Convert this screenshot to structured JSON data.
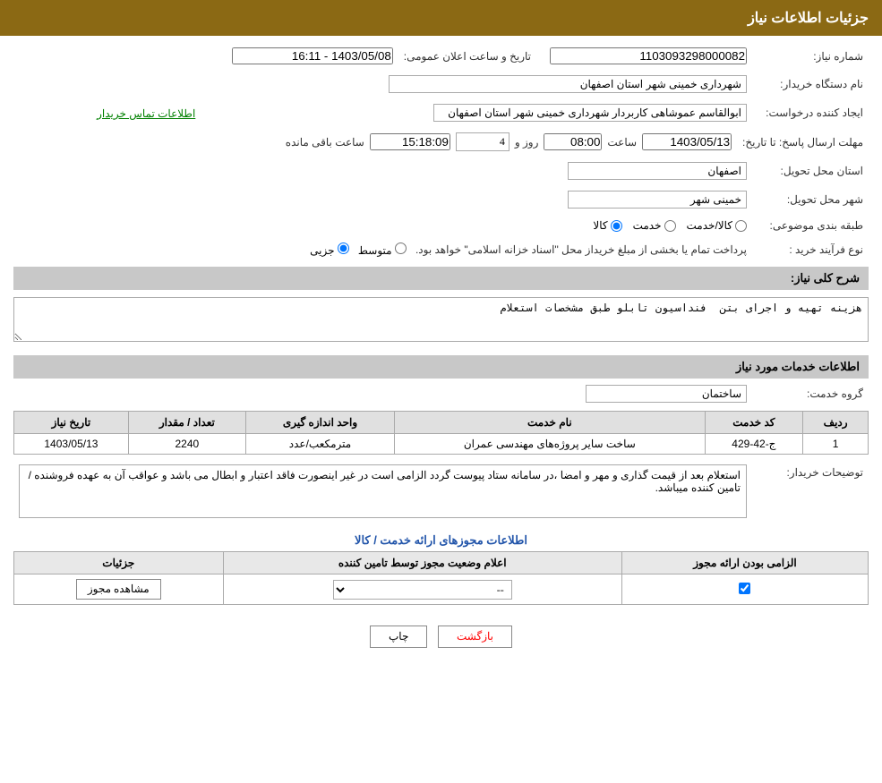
{
  "page": {
    "title": "جزئیات اطلاعات نیاز",
    "header_bg": "#8B6914"
  },
  "fields": {
    "request_number_label": "شماره نیاز:",
    "request_number_value": "1103093298000082",
    "buyer_org_label": "نام دستگاه خریدار:",
    "buyer_org_value": "شهرداری خمینی شهر استان اصفهان",
    "creator_label": "ایجاد کننده درخواست:",
    "creator_value": "ابوالقاسم عموشاهی کاربردار شهرداری خمینی شهر استان اصفهان",
    "contact_link": "اطلاعات تماس خریدار",
    "deadline_label": "مهلت ارسال پاسخ: تا تاریخ:",
    "deadline_date": "1403/05/13",
    "deadline_time_label": "ساعت",
    "deadline_time": "08:00",
    "deadline_days_label": "روز و",
    "deadline_days": "4",
    "deadline_remain_label": "ساعت باقی مانده",
    "deadline_remain": "15:18:09",
    "announce_label": "تاریخ و ساعت اعلان عمومی:",
    "announce_value": "1403/05/08 - 16:11",
    "province_label": "استان محل تحویل:",
    "province_value": "اصفهان",
    "city_label": "شهر محل تحویل:",
    "city_value": "خمینی شهر",
    "category_label": "طبقه بندی موضوعی:",
    "category_kala": "کالا",
    "category_khadamat": "خدمت",
    "category_kala_khadamat": "کالا/خدمت",
    "process_label": "نوع فرآیند خرید :",
    "process_jazii": "جزیی",
    "process_motovaset": "متوسط",
    "process_desc": "پرداخت تمام یا بخشی از مبلغ خریداز محل \"اسناد خزانه اسلامی\" خواهد بود.",
    "need_desc_label": "شرح کلی نیاز:",
    "need_desc_value": "هزینه تهیه و اجرای بتن فنداسیون تابلو طبق مشخصات استعلام",
    "services_section_label": "اطلاعات خدمات مورد نیاز",
    "service_group_label": "گروه خدمت:",
    "service_group_value": "ساختمان",
    "table_headers": {
      "row_num": "ردیف",
      "service_code": "کد خدمت",
      "service_name": "نام خدمت",
      "unit": "واحد اندازه گیری",
      "quantity": "تعداد / مقدار",
      "date": "تاریخ نیاز"
    },
    "table_rows": [
      {
        "row": "1",
        "code": "ج-42-429",
        "name": "ساخت سایر پروژه‌های مهندسی عمران",
        "unit": "مترمکعب/عدد",
        "quantity": "2240",
        "date": "1403/05/13"
      }
    ],
    "buyer_notes_label": "توضیحات خریدار:",
    "buyer_notes_value": "استعلام بعد از قیمت گذاری و مهر و امضا ،در سامانه ستاد پیوست گردد الزامی است در غیر اینصورت فاقد اعتبار و ابطال می باشد و عواقب آن به عهده فروشنده /تامین کننده میباشد.",
    "license_section_label": "اطلاعات مجوزهای ارائه خدمت / کالا",
    "license_table_headers": {
      "required": "الزامی بودن ارائه مجوز",
      "status": "اعلام وضعیت مجوز توسط تامین کننده",
      "details": "جزئیات"
    },
    "license_rows": [
      {
        "required": "✓",
        "status": "--",
        "details": "مشاهده مجوز"
      }
    ],
    "btn_print": "چاپ",
    "btn_back": "بازگشت"
  }
}
